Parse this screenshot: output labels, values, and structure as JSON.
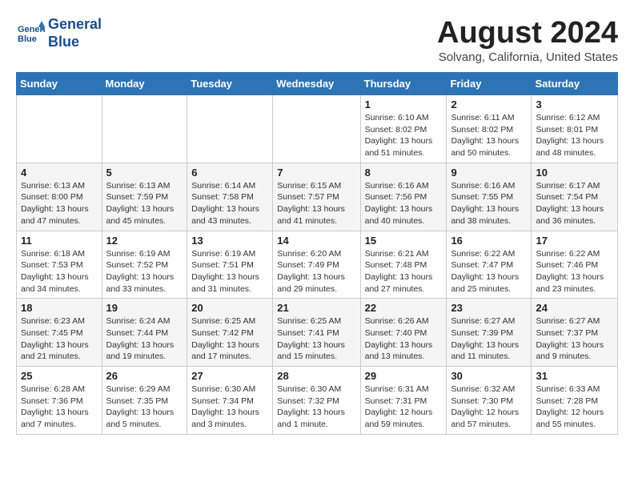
{
  "logo": {
    "line1": "General",
    "line2": "Blue"
  },
  "title": "August 2024",
  "location": "Solvang, California, United States",
  "days_header": [
    "Sunday",
    "Monday",
    "Tuesday",
    "Wednesday",
    "Thursday",
    "Friday",
    "Saturday"
  ],
  "weeks": [
    [
      {
        "day": "",
        "info": ""
      },
      {
        "day": "",
        "info": ""
      },
      {
        "day": "",
        "info": ""
      },
      {
        "day": "",
        "info": ""
      },
      {
        "day": "1",
        "info": "Sunrise: 6:10 AM\nSunset: 8:02 PM\nDaylight: 13 hours\nand 51 minutes."
      },
      {
        "day": "2",
        "info": "Sunrise: 6:11 AM\nSunset: 8:02 PM\nDaylight: 13 hours\nand 50 minutes."
      },
      {
        "day": "3",
        "info": "Sunrise: 6:12 AM\nSunset: 8:01 PM\nDaylight: 13 hours\nand 48 minutes."
      }
    ],
    [
      {
        "day": "4",
        "info": "Sunrise: 6:13 AM\nSunset: 8:00 PM\nDaylight: 13 hours\nand 47 minutes."
      },
      {
        "day": "5",
        "info": "Sunrise: 6:13 AM\nSunset: 7:59 PM\nDaylight: 13 hours\nand 45 minutes."
      },
      {
        "day": "6",
        "info": "Sunrise: 6:14 AM\nSunset: 7:58 PM\nDaylight: 13 hours\nand 43 minutes."
      },
      {
        "day": "7",
        "info": "Sunrise: 6:15 AM\nSunset: 7:57 PM\nDaylight: 13 hours\nand 41 minutes."
      },
      {
        "day": "8",
        "info": "Sunrise: 6:16 AM\nSunset: 7:56 PM\nDaylight: 13 hours\nand 40 minutes."
      },
      {
        "day": "9",
        "info": "Sunrise: 6:16 AM\nSunset: 7:55 PM\nDaylight: 13 hours\nand 38 minutes."
      },
      {
        "day": "10",
        "info": "Sunrise: 6:17 AM\nSunset: 7:54 PM\nDaylight: 13 hours\nand 36 minutes."
      }
    ],
    [
      {
        "day": "11",
        "info": "Sunrise: 6:18 AM\nSunset: 7:53 PM\nDaylight: 13 hours\nand 34 minutes."
      },
      {
        "day": "12",
        "info": "Sunrise: 6:19 AM\nSunset: 7:52 PM\nDaylight: 13 hours\nand 33 minutes."
      },
      {
        "day": "13",
        "info": "Sunrise: 6:19 AM\nSunset: 7:51 PM\nDaylight: 13 hours\nand 31 minutes."
      },
      {
        "day": "14",
        "info": "Sunrise: 6:20 AM\nSunset: 7:49 PM\nDaylight: 13 hours\nand 29 minutes."
      },
      {
        "day": "15",
        "info": "Sunrise: 6:21 AM\nSunset: 7:48 PM\nDaylight: 13 hours\nand 27 minutes."
      },
      {
        "day": "16",
        "info": "Sunrise: 6:22 AM\nSunset: 7:47 PM\nDaylight: 13 hours\nand 25 minutes."
      },
      {
        "day": "17",
        "info": "Sunrise: 6:22 AM\nSunset: 7:46 PM\nDaylight: 13 hours\nand 23 minutes."
      }
    ],
    [
      {
        "day": "18",
        "info": "Sunrise: 6:23 AM\nSunset: 7:45 PM\nDaylight: 13 hours\nand 21 minutes."
      },
      {
        "day": "19",
        "info": "Sunrise: 6:24 AM\nSunset: 7:44 PM\nDaylight: 13 hours\nand 19 minutes."
      },
      {
        "day": "20",
        "info": "Sunrise: 6:25 AM\nSunset: 7:42 PM\nDaylight: 13 hours\nand 17 minutes."
      },
      {
        "day": "21",
        "info": "Sunrise: 6:25 AM\nSunset: 7:41 PM\nDaylight: 13 hours\nand 15 minutes."
      },
      {
        "day": "22",
        "info": "Sunrise: 6:26 AM\nSunset: 7:40 PM\nDaylight: 13 hours\nand 13 minutes."
      },
      {
        "day": "23",
        "info": "Sunrise: 6:27 AM\nSunset: 7:39 PM\nDaylight: 13 hours\nand 11 minutes."
      },
      {
        "day": "24",
        "info": "Sunrise: 6:27 AM\nSunset: 7:37 PM\nDaylight: 13 hours\nand 9 minutes."
      }
    ],
    [
      {
        "day": "25",
        "info": "Sunrise: 6:28 AM\nSunset: 7:36 PM\nDaylight: 13 hours\nand 7 minutes."
      },
      {
        "day": "26",
        "info": "Sunrise: 6:29 AM\nSunset: 7:35 PM\nDaylight: 13 hours\nand 5 minutes."
      },
      {
        "day": "27",
        "info": "Sunrise: 6:30 AM\nSunset: 7:34 PM\nDaylight: 13 hours\nand 3 minutes."
      },
      {
        "day": "28",
        "info": "Sunrise: 6:30 AM\nSunset: 7:32 PM\nDaylight: 13 hours\nand 1 minute."
      },
      {
        "day": "29",
        "info": "Sunrise: 6:31 AM\nSunset: 7:31 PM\nDaylight: 12 hours\nand 59 minutes."
      },
      {
        "day": "30",
        "info": "Sunrise: 6:32 AM\nSunset: 7:30 PM\nDaylight: 12 hours\nand 57 minutes."
      },
      {
        "day": "31",
        "info": "Sunrise: 6:33 AM\nSunset: 7:28 PM\nDaylight: 12 hours\nand 55 minutes."
      }
    ]
  ]
}
